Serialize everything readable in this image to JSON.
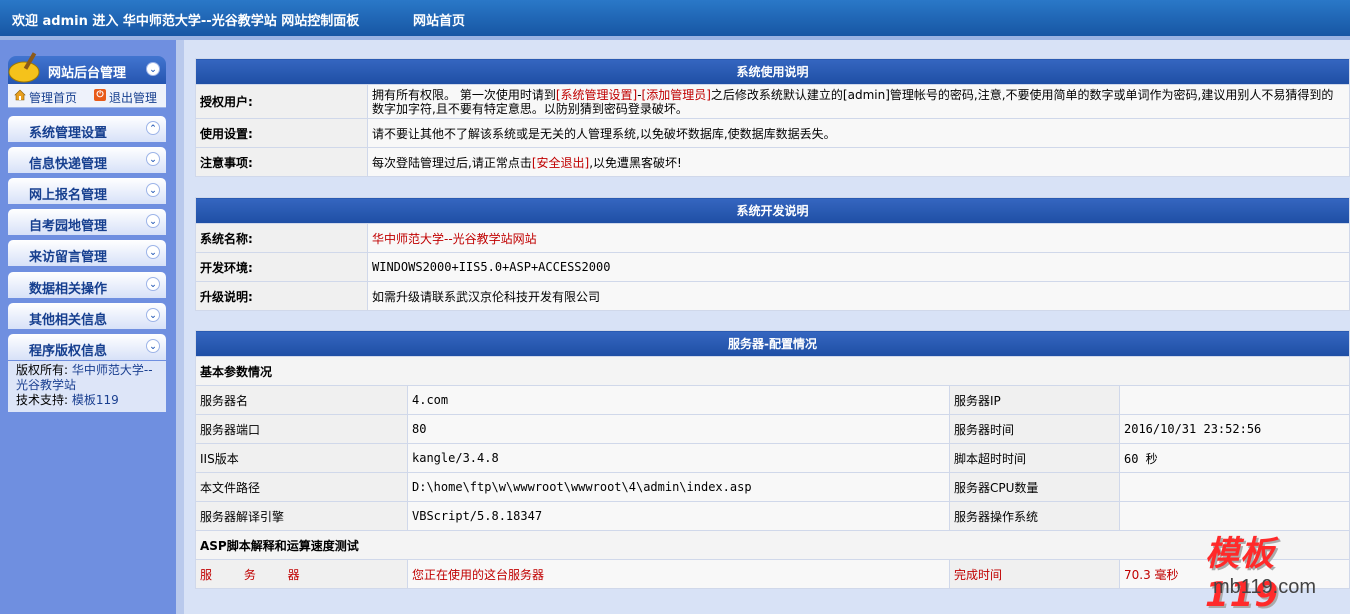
{
  "topbar": {
    "welcome": "欢迎 admin 进入 华中师范大学--光谷教学站 网站控制面板",
    "site_home": "网站首页"
  },
  "sidebar": {
    "title": "网站后台管理",
    "home_link": "管理首页",
    "logout_link": "退出管理",
    "items": [
      {
        "label": "系统管理设置",
        "icon": "chevron-up-icon"
      },
      {
        "label": "信息快递管理",
        "icon": "chevron-down-icon"
      },
      {
        "label": "网上报名管理",
        "icon": "chevron-down-icon"
      },
      {
        "label": "自考园地管理",
        "icon": "chevron-down-icon"
      },
      {
        "label": "来访留言管理",
        "icon": "chevron-down-icon"
      },
      {
        "label": "数据相关操作",
        "icon": "chevron-down-icon"
      },
      {
        "label": "其他相关信息",
        "icon": "chevron-down-icon"
      },
      {
        "label": "程序版权信息",
        "icon": "chevron-down-icon"
      }
    ],
    "copyright": {
      "owner_label": "版权所有:",
      "owner": "华中师范大学--光谷教学站",
      "support_label": "技术支持:",
      "support": "模板119"
    }
  },
  "usage": {
    "heading": "系统使用说明",
    "rows": [
      {
        "label": "授权用户:",
        "pre": "拥有所有权限。 第一次使用时请到",
        "link1": "[系统管理设置]",
        "dash": "-",
        "link2": "[添加管理员]",
        "post": "之后修改系统默认建立的[admin]管理帐号的密码,注意,不要使用简单的数字或单词作为密码,建议用别人不易猜得到的数字加字符,且不要有特定意思。以防别猜到密码登录破坏。"
      },
      {
        "label": "使用设置:",
        "text": "请不要让其他不了解该系统或是无关的人管理系统,以免破坏数据库,使数据库数据丢失。"
      },
      {
        "label": "注意事项:",
        "pre": "每次登陆管理过后,请正常点击",
        "link": "[安全退出]",
        "post": ",以免遭黑客破坏!"
      }
    ]
  },
  "dev": {
    "heading": "系统开发说明",
    "rows": [
      {
        "label": "系统名称:",
        "value": "华中师范大学--光谷教学站网站"
      },
      {
        "label": "开发环境:",
        "value": "WINDOWS2000+IIS5.0+ASP+ACCESS2000"
      },
      {
        "label": "升级说明:",
        "value": "如需升级请联系武汉京伦科技开发有限公司"
      }
    ]
  },
  "server": {
    "heading": "服务器-配置情况",
    "basic_title": "基本参数情况",
    "rows": [
      {
        "k1": "服务器名",
        "v1": "4.com",
        "k2": "服务器IP",
        "v2": ""
      },
      {
        "k1": "服务器端口",
        "v1": "80",
        "k2": "服务器时间",
        "v2": "2016/10/31 23:52:56"
      },
      {
        "k1": "IIS版本",
        "v1": "kangle/3.4.8",
        "k2": "脚本超时时间",
        "v2": "60 秒"
      },
      {
        "k1": "本文件路径",
        "v1": "D:\\home\\ftp\\w\\wwwroot\\wwwroot\\4\\admin\\index.asp",
        "k2": "服务器CPU数量",
        "v2": ""
      },
      {
        "k1": "服务器解译引擎",
        "v1": "VBScript/5.8.18347",
        "k2": "服务器操作系统",
        "v2": ""
      }
    ],
    "speed_title": "ASP脚本解释和运算速度测试",
    "speed": {
      "k1": "服 务 器",
      "v1": "您正在使用的这台服务器",
      "k2": "完成时间",
      "v2": "70.3 毫秒"
    }
  },
  "watermark": {
    "brand": "模板119",
    "url": "mb119.com"
  }
}
